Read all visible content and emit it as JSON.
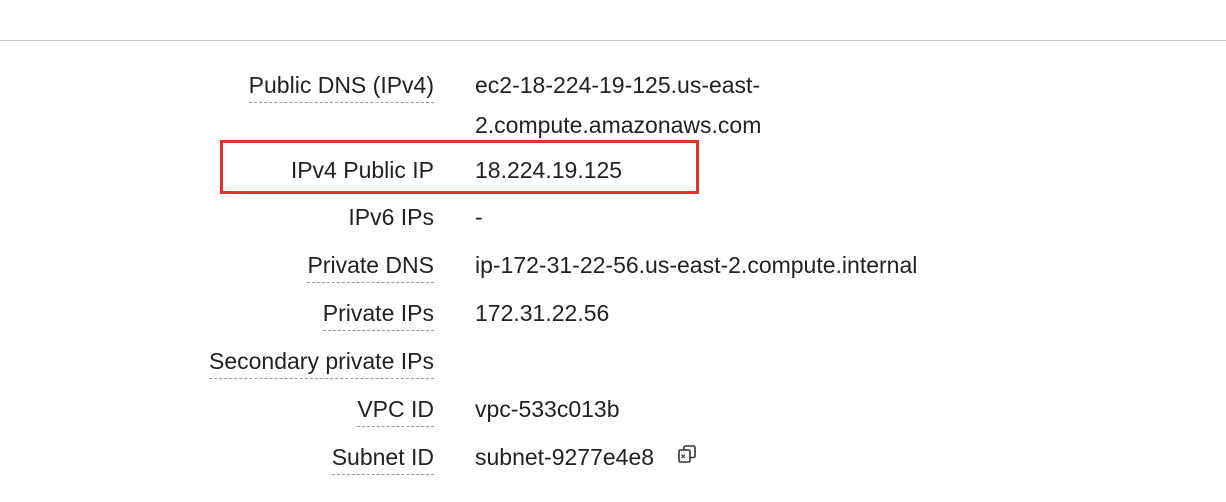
{
  "instance_details": {
    "rows": [
      {
        "label": "Public DNS (IPv4)",
        "value": "ec2-18-224-19-125.us-east-2.compute.amazonaws.com"
      },
      {
        "label": "IPv4 Public IP",
        "value": "18.224.19.125"
      },
      {
        "label": "IPv6 IPs",
        "value": "-"
      },
      {
        "label": "Private DNS",
        "value": "ip-172-31-22-56.us-east-2.compute.internal"
      },
      {
        "label": "Private IPs",
        "value": "172.31.22.56"
      },
      {
        "label": "Secondary private IPs",
        "value": ""
      },
      {
        "label": "VPC ID",
        "value": "vpc-533c013b"
      },
      {
        "label": "Subnet ID",
        "value": "subnet-9277e4e8"
      }
    ],
    "public_dns_line1": "ec2-18-224-19-125.us-east-",
    "public_dns_line2": "2.compute.amazonaws.com"
  },
  "icons": {
    "subnet_copy": "copy-icon"
  },
  "colors": {
    "highlight": "#e8312b",
    "text": "#222222",
    "divider": "#c7c7c7"
  }
}
